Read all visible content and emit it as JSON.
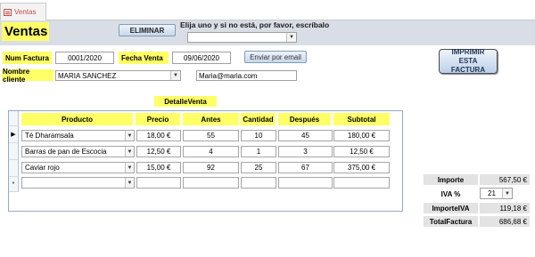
{
  "tab": {
    "label": "Ventas"
  },
  "form": {
    "title": "Ventas",
    "eliminar_label": "ELIMINAR",
    "search_hint": "Elija uno y si no está, por favor, escríbalo",
    "search_value": "",
    "num_factura_label": "Num Factura",
    "num_factura_value": "0001/2020",
    "fecha_label": "Fecha Venta",
    "fecha_value": "09/06/2020",
    "email_button_label": "Enviar por email",
    "print_button_label": "IMPRIMIR ESTA FACTURA",
    "cliente_label": "Nombre cliente",
    "cliente_value": "MARIA SANCHEZ",
    "email_value": "Maria@maria.com"
  },
  "detalle": {
    "title": "DetalleVenta",
    "columns": [
      "Producto",
      "Precio",
      "Antes",
      "Cantidad",
      "Después",
      "Subtotal"
    ],
    "rows": [
      {
        "selector": "▶",
        "producto": "Té Dharamsala",
        "precio": "18,00 €",
        "antes": "55",
        "cantidad": "10",
        "despues": "45",
        "subtotal": "180,00 €"
      },
      {
        "selector": "",
        "producto": "Barras de pan de Escocia",
        "precio": "12,50 €",
        "antes": "4",
        "cantidad": "1",
        "despues": "3",
        "subtotal": "12,50 €"
      },
      {
        "selector": "",
        "producto": "Caviar rojo",
        "precio": "15,00 €",
        "antes": "92",
        "cantidad": "25",
        "despues": "67",
        "subtotal": "375,00 €"
      },
      {
        "selector": "*",
        "producto": "",
        "precio": "",
        "antes": "",
        "cantidad": "",
        "despues": "",
        "subtotal": ""
      }
    ]
  },
  "totals": {
    "importe_label": "Importe",
    "importe_value": "567,50 €",
    "iva_label": "IVA %",
    "iva_value": "21",
    "importe_iva_label": "ImporteIVA",
    "importe_iva_value": "119,18 €",
    "total_label": "TotalFactura",
    "total_value": "686,68 €"
  },
  "icons": {
    "tab": "form-icon",
    "dropdown": "chevron-down-icon"
  },
  "colors": {
    "label_background": "#ffff66",
    "header_band": "#d9dde6",
    "tab_text": "#c0504d",
    "grid_border": "#93a9c9"
  }
}
